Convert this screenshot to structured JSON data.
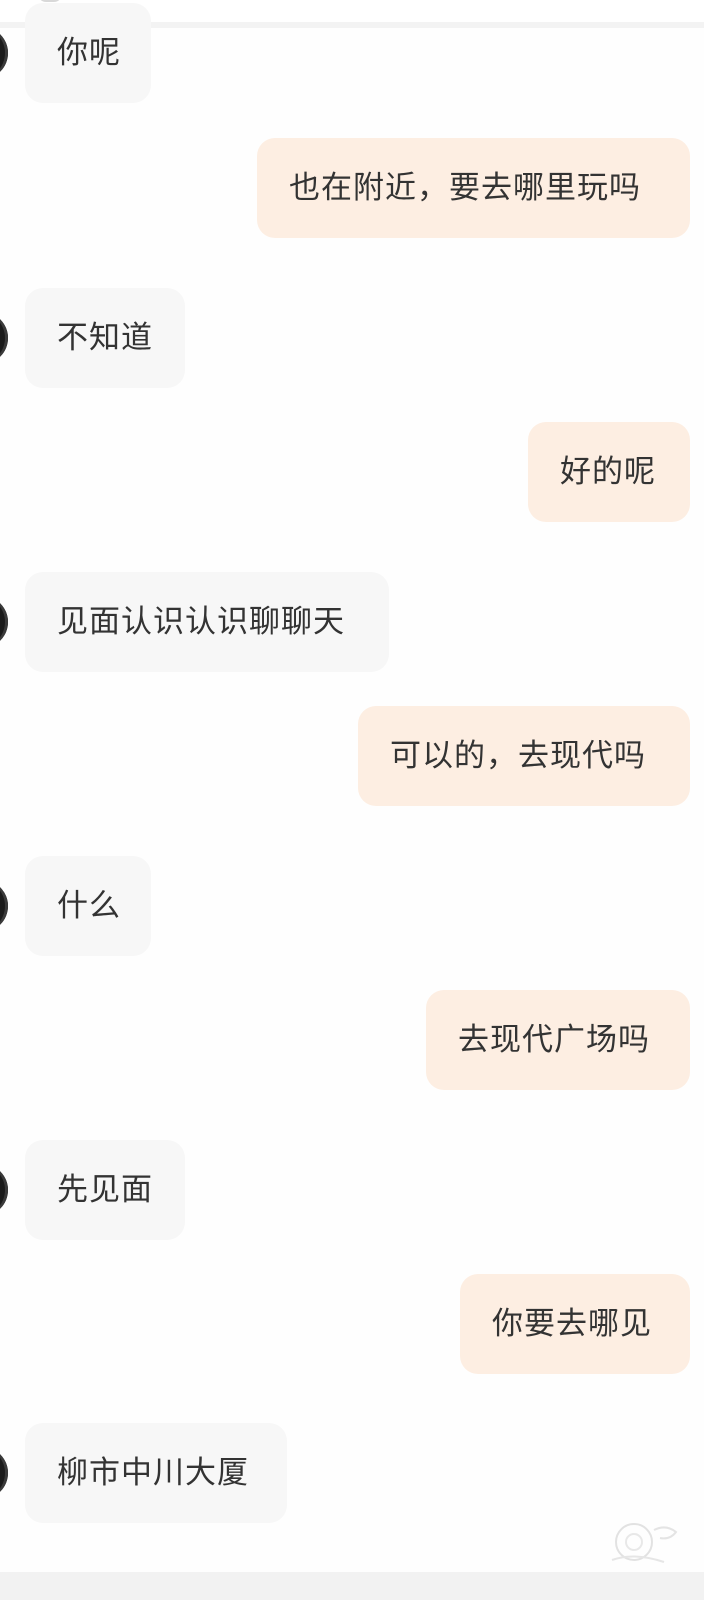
{
  "chat": {
    "messages": [
      {
        "side": "in",
        "text": "你呢"
      },
      {
        "side": "out",
        "text": "也在附近，要去哪里玩吗"
      },
      {
        "side": "in",
        "text": "不知道"
      },
      {
        "side": "out",
        "text": "好的呢"
      },
      {
        "side": "in",
        "text": "见面认识认识聊聊天"
      },
      {
        "side": "out",
        "text": "可以的，去现代吗"
      },
      {
        "side": "in",
        "text": "什么"
      },
      {
        "side": "out",
        "text": "去现代广场吗"
      },
      {
        "side": "in",
        "text": "先见面"
      },
      {
        "side": "out",
        "text": "你要去哪见"
      },
      {
        "side": "in",
        "text": "柳市中川大厦"
      }
    ]
  },
  "colors": {
    "incoming_bubble": "#f7f7f7",
    "outgoing_bubble": "#fdeee2",
    "message_text": "#333333",
    "background": "#fefefe"
  },
  "icons": {
    "avatar": "contact-avatar",
    "watermark": "app-watermark"
  }
}
